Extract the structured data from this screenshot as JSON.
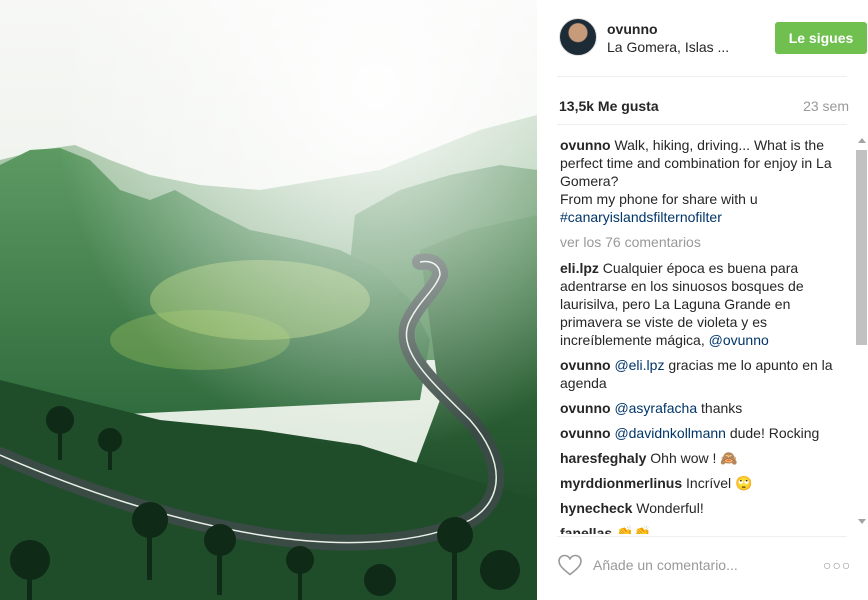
{
  "post": {
    "username": "ovunno",
    "location": "La Gomera, Islas ...",
    "follow_label": "Le sigues",
    "likes": "13,5k Me gusta",
    "age": "23 sem"
  },
  "caption": {
    "author": "ovunno",
    "text": "Walk, hiking, driving... What is the perfect time and combination for enjoy in La Gomera?",
    "text2": "From my phone for share with u",
    "hashtag": "#canaryislandsfilternofilter"
  },
  "view_more": "ver los 76 comentarios",
  "comments": [
    {
      "author": "eli.lpz",
      "text": "Cualquier época es buena para adentrarse en los sinuosos bosques de laurisilva, pero La Laguna Grande en primavera se viste de violeta y es increíblemente mágica,",
      "mention": "@ovunno",
      "after": ""
    },
    {
      "author": "ovunno",
      "text": "",
      "mention": "@eli.lpz",
      "after": "gracias me lo apunto en la agenda"
    },
    {
      "author": "ovunno",
      "text": "",
      "mention": "@asyrafacha",
      "after": "thanks"
    },
    {
      "author": "ovunno",
      "text": "",
      "mention": "@davidnkollmann",
      "after": "dude! Rocking"
    },
    {
      "author": "haresfeghaly",
      "text": "Ohh wow ! 🙈",
      "mention": "",
      "after": ""
    },
    {
      "author": "myrddionmerlinus",
      "text": "Incrível 🙄",
      "mention": "",
      "after": ""
    },
    {
      "author": "hynecheck",
      "text": "Wonderful!",
      "mention": "",
      "after": ""
    },
    {
      "author": "fanellas",
      "text": "👏👏",
      "mention": "",
      "after": ""
    }
  ],
  "add_comment": {
    "placeholder": "Añade un comentario...",
    "more_label": "○○○"
  },
  "icons": {
    "like": "heart-outline-icon",
    "more": "more-options-icon",
    "scroll_up": "chevron-up-icon",
    "scroll_down": "chevron-down-icon"
  },
  "colors": {
    "follow_button": "#70c050",
    "link": "#003569",
    "muted": "#999999"
  }
}
